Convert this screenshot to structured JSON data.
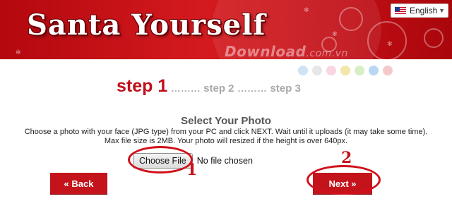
{
  "header": {
    "logo_text": "Santa Yourself",
    "language": {
      "selected": "English",
      "flag_icon": "us-flag-icon",
      "caret_icon": "dropdown-caret-icon"
    },
    "watermark": {
      "main": "Download",
      "suffix": ".com.vn"
    }
  },
  "decor_dots": [
    "#cfe3f7",
    "#e7e7e7",
    "#f8d6e0",
    "#f2e6a8",
    "#d8efc5",
    "#b9d7f2",
    "#f5c9c9"
  ],
  "steps": {
    "step1": "step 1",
    "sep1": "………",
    "step2": "step 2",
    "sep2": "………",
    "step3": "step 3"
  },
  "main": {
    "title": "Select Your Photo",
    "description_line1": "Choose a photo with your face (JPG type) from your PC and click NEXT. Wait until it uploads (it may take some time).",
    "description_line2": "Max file size is 2MB. Your photo will resized if the height is over 640px.",
    "choose_file_label": "Choose File",
    "no_file_text": "No file chosen"
  },
  "annotations": {
    "marker1": "1",
    "marker2": "2",
    "color": "#d0101a"
  },
  "nav": {
    "back_label": "« Back",
    "next_label": "Next »"
  }
}
